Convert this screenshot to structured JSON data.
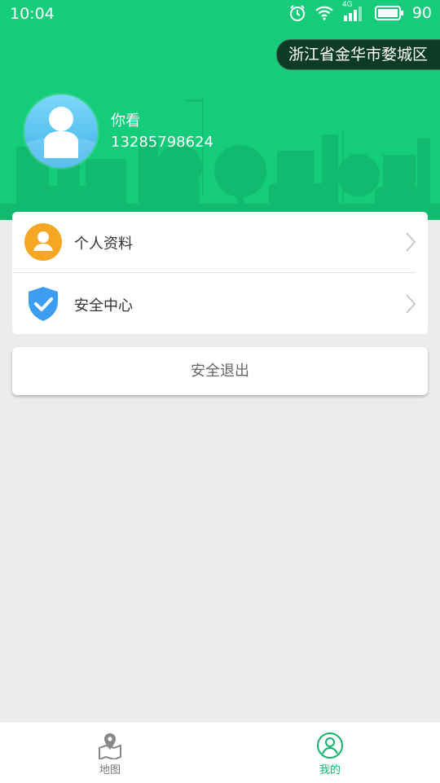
{
  "status_bar": {
    "time": "10:04",
    "network": "4G",
    "battery": "90",
    "icons": [
      "alarm-icon",
      "wifi-icon",
      "signal-icon",
      "battery-icon"
    ]
  },
  "header": {
    "region": "浙江省金华市婺城区",
    "bg_color": "#14cc7a"
  },
  "user": {
    "name": "你看",
    "phone": "13285798624"
  },
  "menu": {
    "items": [
      {
        "label": "个人资料",
        "icon": "user-profile-icon"
      },
      {
        "label": "安全中心",
        "icon": "shield-check-icon"
      }
    ]
  },
  "logout": {
    "label": "安全退出"
  },
  "bottom_nav": {
    "items": [
      {
        "label": "地图",
        "icon": "map-icon",
        "active": false
      },
      {
        "label": "我的",
        "icon": "user-circle-icon",
        "active": true
      }
    ],
    "active_color": "#14b36d"
  }
}
